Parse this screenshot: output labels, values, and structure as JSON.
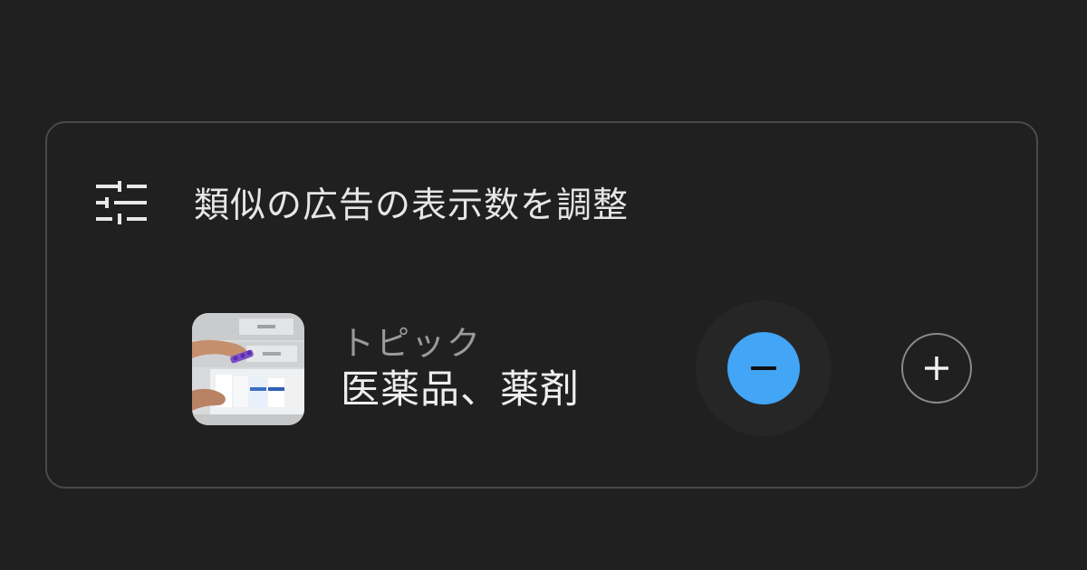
{
  "panel": {
    "title": "類似の広告の表示数を調整",
    "title_icon": "tune-icon"
  },
  "topic": {
    "kind_label": "トピック",
    "name": "医薬品、薬剤",
    "thumbnail": "pharmacy-drawer-thumbnail"
  },
  "controls": {
    "decrease_icon": "minus-icon",
    "increase_icon": "plus-icon",
    "decrease_selected": true
  },
  "colors": {
    "background": "#202020",
    "accent": "#42a5f5",
    "border": "#4a4a4a"
  }
}
